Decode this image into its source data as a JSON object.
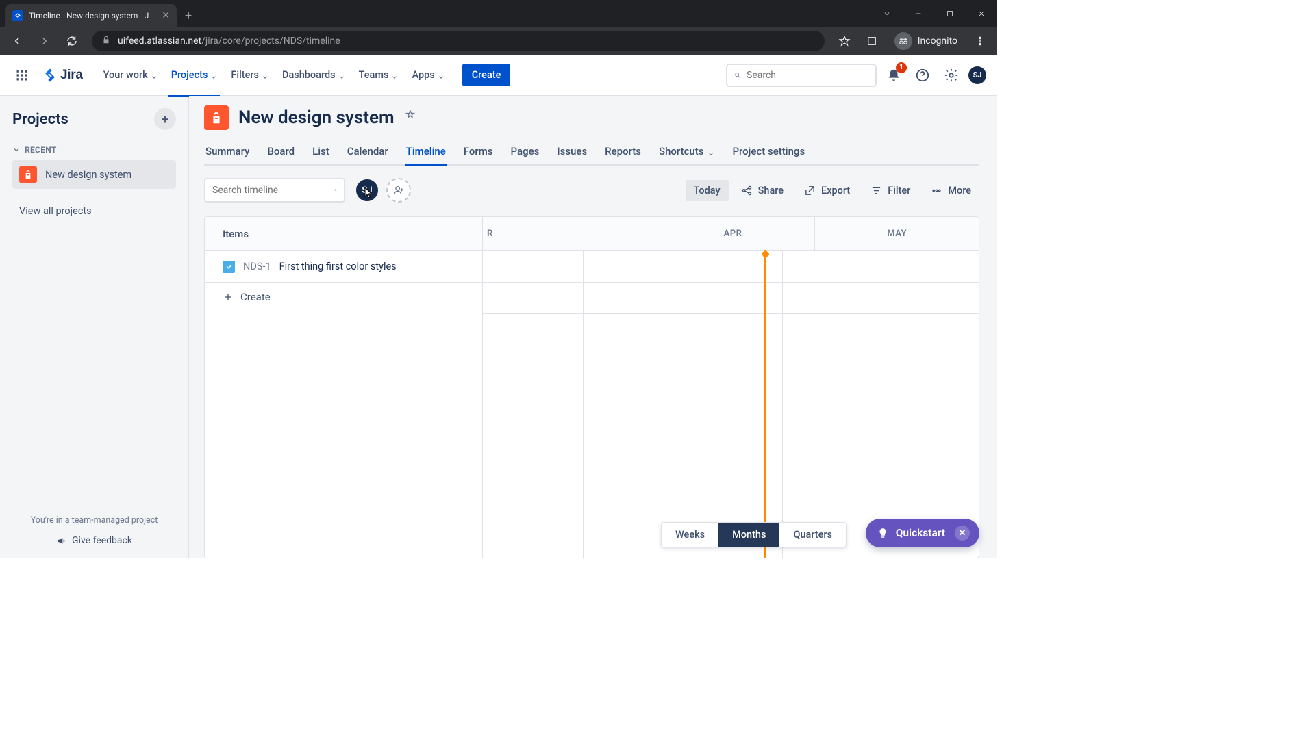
{
  "browser": {
    "tab_title": "Timeline - New design system - J",
    "url_domain": "uifeed.atlassian.net",
    "url_path": "/jira/core/projects/NDS/timeline",
    "incognito_label": "Incognito"
  },
  "nav": {
    "product": "Jira",
    "items": [
      "Your work",
      "Projects",
      "Filters",
      "Dashboards",
      "Teams",
      "Apps"
    ],
    "active_index": 1,
    "create_label": "Create",
    "search_placeholder": "Search",
    "notification_count": "1",
    "avatar_initials": "SJ"
  },
  "sidebar": {
    "title": "Projects",
    "section_label": "RECENT",
    "projects": [
      {
        "name": "New design system"
      }
    ],
    "view_all": "View all projects",
    "footer_note": "You're in a team-managed project",
    "feedback_label": "Give feedback"
  },
  "project": {
    "name": "New design system",
    "tabs": [
      "Summary",
      "Board",
      "List",
      "Calendar",
      "Timeline",
      "Forms",
      "Pages",
      "Issues",
      "Reports",
      "Shortcuts",
      "Project settings"
    ],
    "active_tab_index": 4
  },
  "toolbar": {
    "search_placeholder": "Search timeline",
    "user_initials": "SJ",
    "today_label": "Today",
    "share_label": "Share",
    "export_label": "Export",
    "filter_label": "Filter",
    "more_label": "More"
  },
  "timeline": {
    "items_header": "Items",
    "months": [
      "R",
      "APR",
      "MAY"
    ],
    "rows": [
      {
        "key": "NDS-1",
        "summary": "First thing first color styles"
      }
    ],
    "create_label": "Create",
    "zoom_options": [
      "Weeks",
      "Months",
      "Quarters"
    ],
    "zoom_active_index": 1
  },
  "quickstart": {
    "label": "Quickstart"
  }
}
